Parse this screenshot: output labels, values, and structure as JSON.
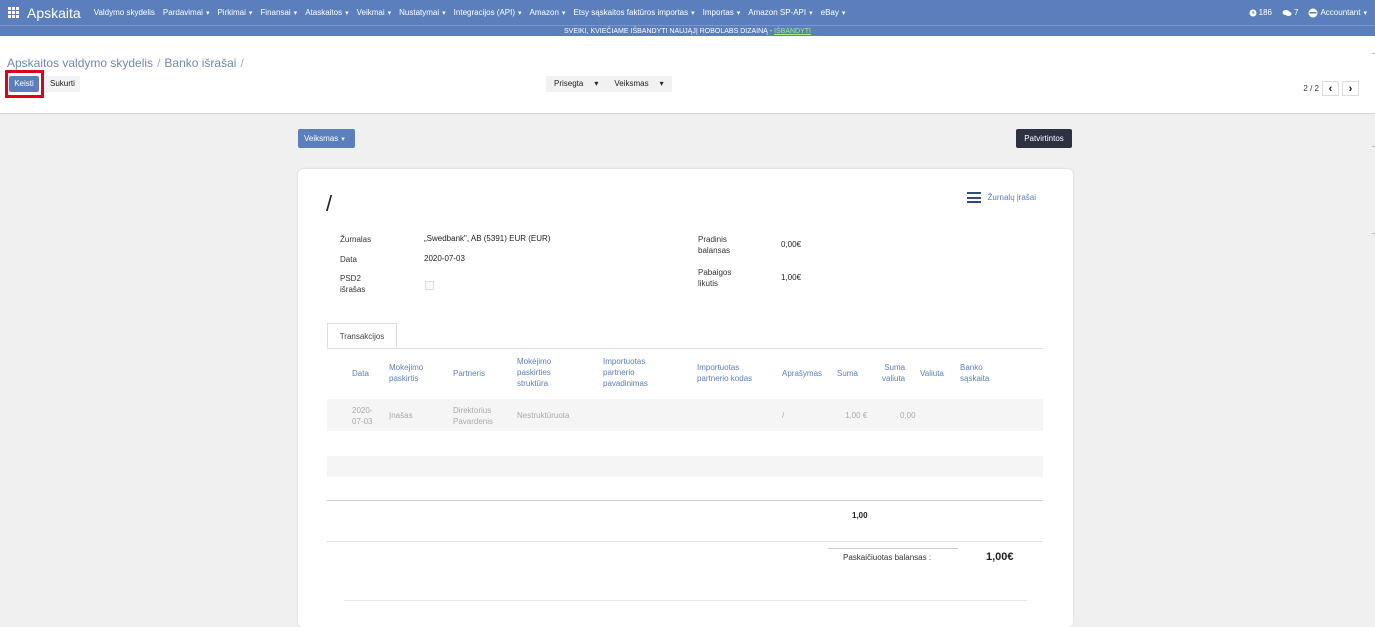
{
  "navbar": {
    "brand": "Apskaita",
    "menu": [
      {
        "label": "Valdymo skydelis",
        "caret": false
      },
      {
        "label": "Pardavimai",
        "caret": true
      },
      {
        "label": "Pirkimai",
        "caret": true
      },
      {
        "label": "Finansai",
        "caret": true
      },
      {
        "label": "Ataskaitos",
        "caret": true
      },
      {
        "label": "Veikmai",
        "caret": true
      },
      {
        "label": "Nustatymai",
        "caret": true
      },
      {
        "label": "Integracijos (API)",
        "caret": true
      },
      {
        "label": "Amazon",
        "caret": true
      },
      {
        "label": "Etsy sąskaitos faktūros importas",
        "caret": true
      },
      {
        "label": "Importas",
        "caret": true
      },
      {
        "label": "Amazon SP-API",
        "caret": true
      },
      {
        "label": "eBay",
        "caret": true
      }
    ],
    "activity_count": "186",
    "messages_count": "7",
    "user": "Accountant"
  },
  "banner": {
    "text": "SVEIKI, KVIEČIAME IŠBANDYTI NAUJĄJĮ ROBOLABS DIZAINĄ - ",
    "link": "IŠBANDYTI"
  },
  "breadcrumb": {
    "item1": "Apskaitos valdymo skydelis",
    "item2": "Banko išrašai",
    "item3": ""
  },
  "buttons": {
    "edit": "Keisti",
    "create": "Sukurti",
    "attached": "Prisegta",
    "action": "Veiksmas",
    "status": "Patvirtintos"
  },
  "pager": {
    "text": "2 / 2"
  },
  "record": {
    "title": "/",
    "journal_entries_link": "Žurnalų įrašai",
    "fields": {
      "journal_label": "Žurnalas",
      "journal_value": "„Swedbank\", AB (5391) EUR (EUR)",
      "date_label": "Data",
      "date_value": "2020-07-03",
      "psd2_label_1": "PSD2",
      "psd2_label_2": "išrašas",
      "start_balance_label_1": "Pradinis",
      "start_balance_label_2": "balansas",
      "start_balance_value": "0,00€",
      "end_balance_label_1": "Pabaigos",
      "end_balance_label_2": "likutis",
      "end_balance_value": "1,00€"
    }
  },
  "tabs": {
    "transactions": "Transakcijos"
  },
  "table": {
    "headers": {
      "date": "Data",
      "purpose_1": "Mokejimo",
      "purpose_2": "paskirtis",
      "partner": "Partneris",
      "structure_1": "Mokėjimo",
      "structure_2": "paskirties",
      "structure_3": "struktūra",
      "imp_name_1": "Importuotas",
      "imp_name_2": "partnerio",
      "imp_name_3": "pavadinimas",
      "imp_code_1": "Importuotas",
      "imp_code_2": "partnerio kodas",
      "description": "Aprašymas",
      "amount": "Suma",
      "amount_cur_1": "Suma",
      "amount_cur_2": "valiuta",
      "currency": "Valiuta",
      "bank_1": "Banko",
      "bank_2": "sąskaita"
    },
    "row": {
      "date_1": "2020-",
      "date_2": "07-03",
      "purpose": "Įnašas",
      "partner_1": "Direktorius",
      "partner_2": "Pavardenis",
      "structure": "Nestruktūruota",
      "description": "/",
      "amount": "1,00 €",
      "amount_cur": "0,00"
    },
    "total": "1,00",
    "computed_balance_label": "Paskaičiuotas balansas :",
    "computed_balance_value": "1,00€"
  }
}
